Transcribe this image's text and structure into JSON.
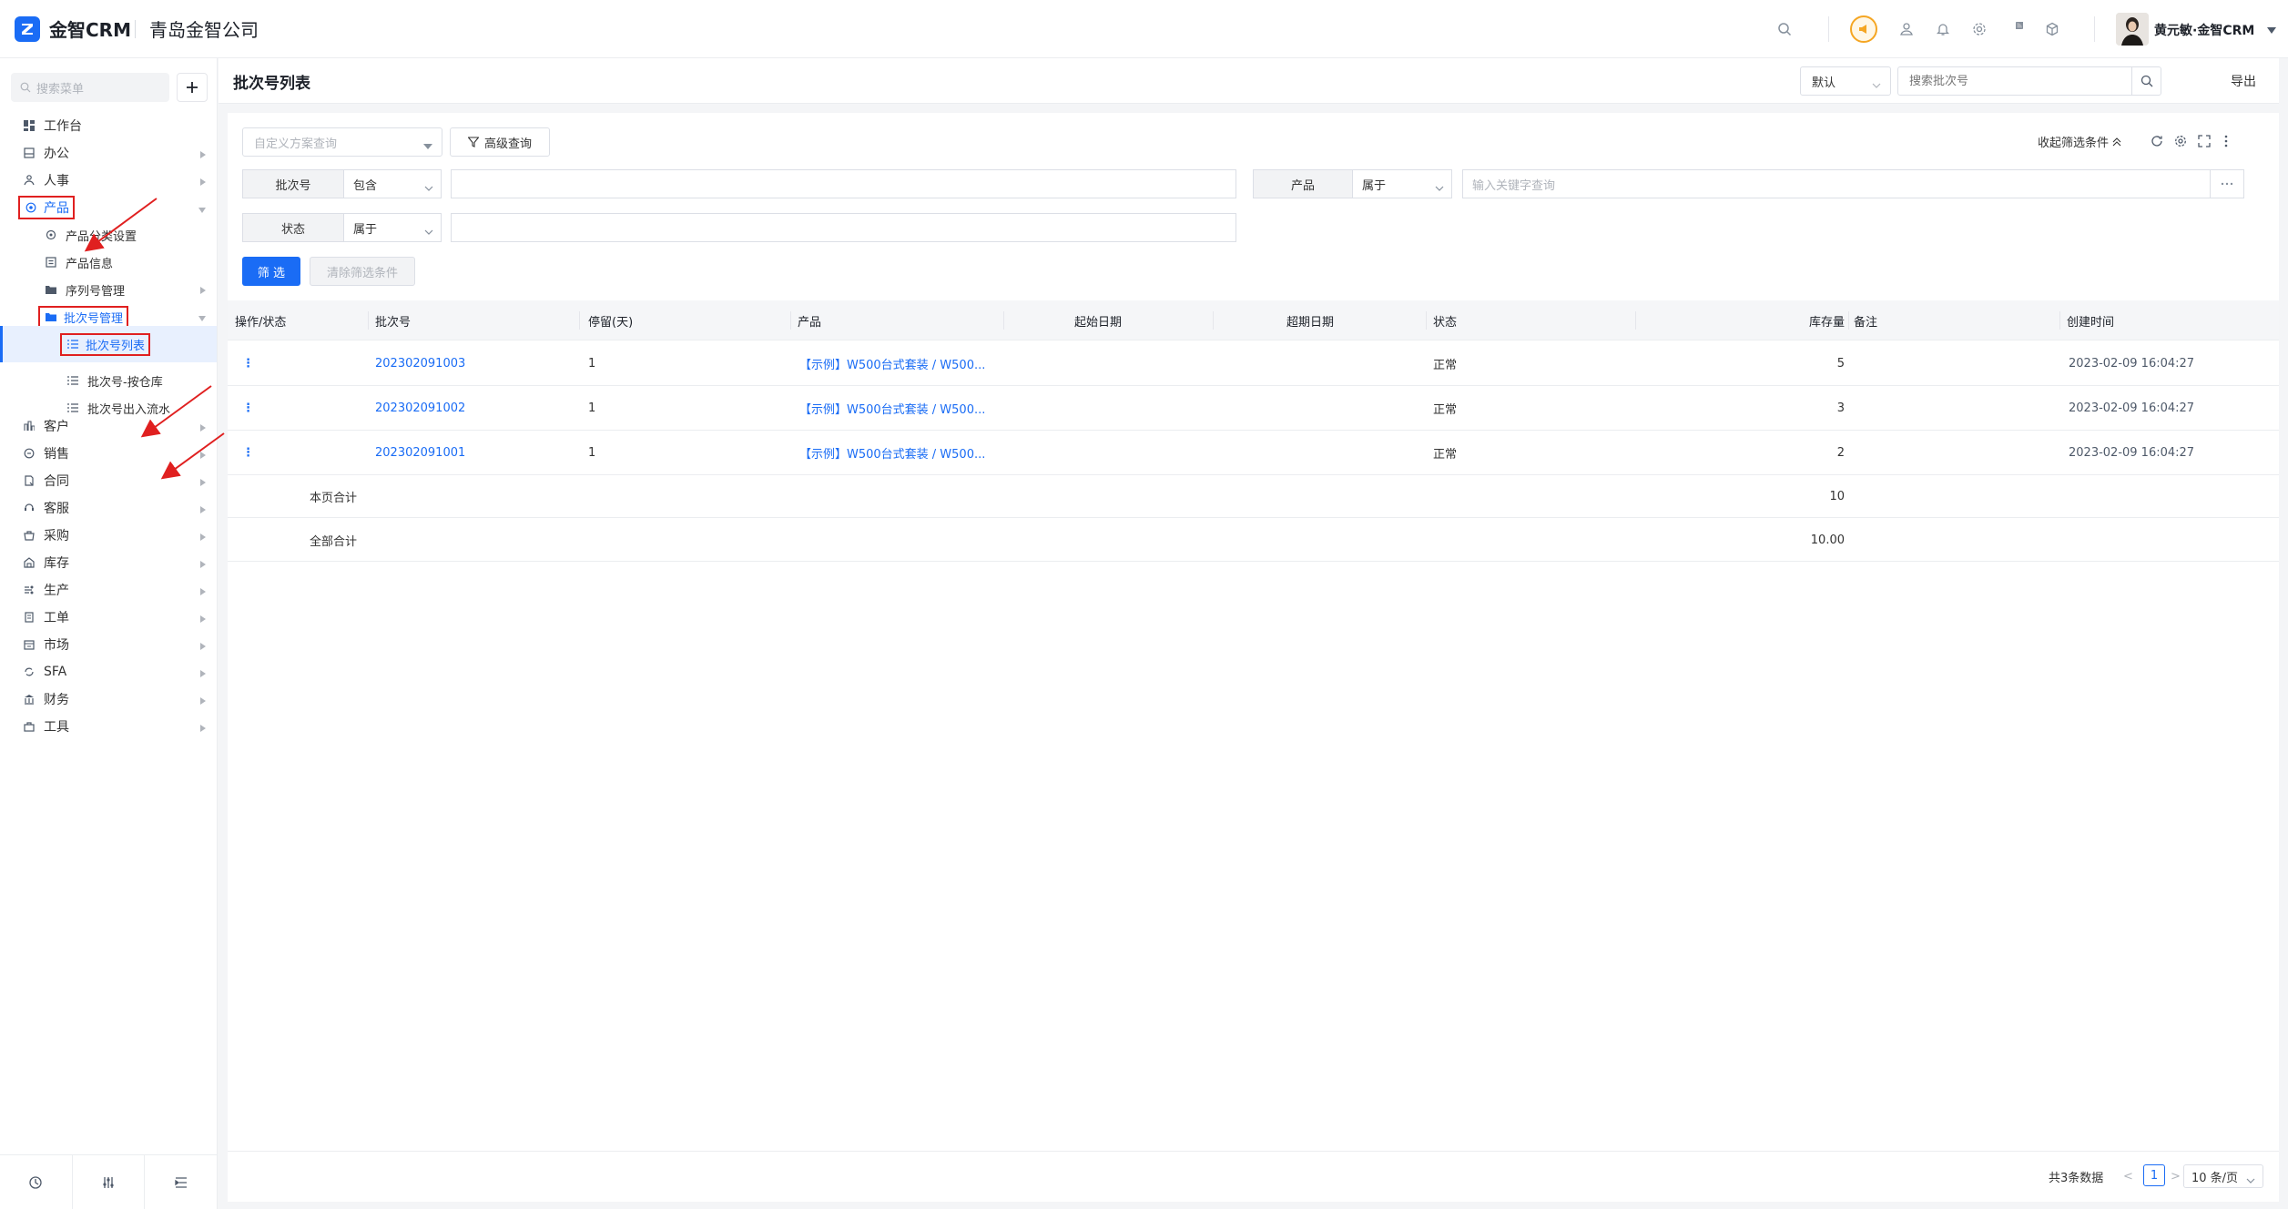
{
  "app": {
    "name": "金智CRM",
    "company": "青岛金智公司"
  },
  "user": {
    "name": "黄元敏·金智CRM"
  },
  "colors": {
    "primary": "#1a6cf5",
    "highlight": "#e02020",
    "accent_orange": "#f5a623"
  },
  "sidebar": {
    "search_placeholder": "搜索菜单",
    "items": [
      {
        "label": "工作台",
        "icon": "dashboard-icon"
      },
      {
        "label": "办公",
        "icon": "office-icon"
      },
      {
        "label": "人事",
        "icon": "hr-icon"
      },
      {
        "label": "产品",
        "icon": "product-icon"
      },
      {
        "label": "产品分类设置",
        "icon": "category-settings-icon"
      },
      {
        "label": "产品信息",
        "icon": "product-info-icon"
      },
      {
        "label": "序列号管理",
        "icon": "folder-icon"
      },
      {
        "label": "批次号管理",
        "icon": "folder-icon"
      },
      {
        "label": "批次号列表",
        "icon": "list-icon"
      },
      {
        "label": "批次号-按仓库",
        "icon": "list-icon"
      },
      {
        "label": "批次号出入流水",
        "icon": "list-icon"
      },
      {
        "label": "客户",
        "icon": "customer-icon"
      },
      {
        "label": "销售",
        "icon": "sales-icon"
      },
      {
        "label": "合同",
        "icon": "contract-icon"
      },
      {
        "label": "客服",
        "icon": "service-icon"
      },
      {
        "label": "采购",
        "icon": "purchase-icon"
      },
      {
        "label": "库存",
        "icon": "inventory-icon"
      },
      {
        "label": "生产",
        "icon": "production-icon"
      },
      {
        "label": "工单",
        "icon": "work-order-icon"
      },
      {
        "label": "市场",
        "icon": "market-icon"
      },
      {
        "label": "SFA",
        "icon": "sfa-icon"
      },
      {
        "label": "财务",
        "icon": "finance-icon"
      },
      {
        "label": "工具",
        "icon": "tools-icon"
      }
    ]
  },
  "header": {
    "title": "批次号列表",
    "view_select": "默认",
    "search_placeholder": "搜索批次号",
    "export_label": "导出"
  },
  "filters": {
    "scheme_placeholder": "自定义方案查询",
    "advanced_label": "高级查询",
    "collapse_label": "收起筛选条件",
    "rows": [
      {
        "label": "批次号",
        "op": "包含",
        "value": ""
      },
      {
        "label": "产品",
        "op": "属于",
        "placeholder": "输入关键字查询"
      },
      {
        "label": "状态",
        "op": "属于",
        "value": ""
      }
    ],
    "submit_label": "筛 选",
    "clear_label": "清除筛选条件"
  },
  "table": {
    "columns": [
      "操作/状态",
      "批次号",
      "停留(天)",
      "产品",
      "起始日期",
      "超期日期",
      "状态",
      "库存量",
      "备注",
      "创建时间"
    ],
    "rows": [
      {
        "batch": "202302091003",
        "stay": "1",
        "product": "【示例】W500台式套装 / W500...",
        "start": "",
        "expire": "",
        "status": "正常",
        "qty": "5",
        "note": "",
        "created": "2023-02-09 16:04:27"
      },
      {
        "batch": "202302091002",
        "stay": "1",
        "product": "【示例】W500台式套装 / W500...",
        "start": "",
        "expire": "",
        "status": "正常",
        "qty": "3",
        "note": "",
        "created": "2023-02-09 16:04:27"
      },
      {
        "batch": "202302091001",
        "stay": "1",
        "product": "【示例】W500台式套装 / W500...",
        "start": "",
        "expire": "",
        "status": "正常",
        "qty": "2",
        "note": "",
        "created": "2023-02-09 16:04:27"
      }
    ],
    "page_total_label": "本页合计",
    "page_total_qty": "10",
    "all_total_label": "全部合计",
    "all_total_qty": "10.00"
  },
  "pagination": {
    "total_text": "共3条数据",
    "prev": "<",
    "current": "1",
    "next": ">",
    "page_size": "10 条/页"
  }
}
